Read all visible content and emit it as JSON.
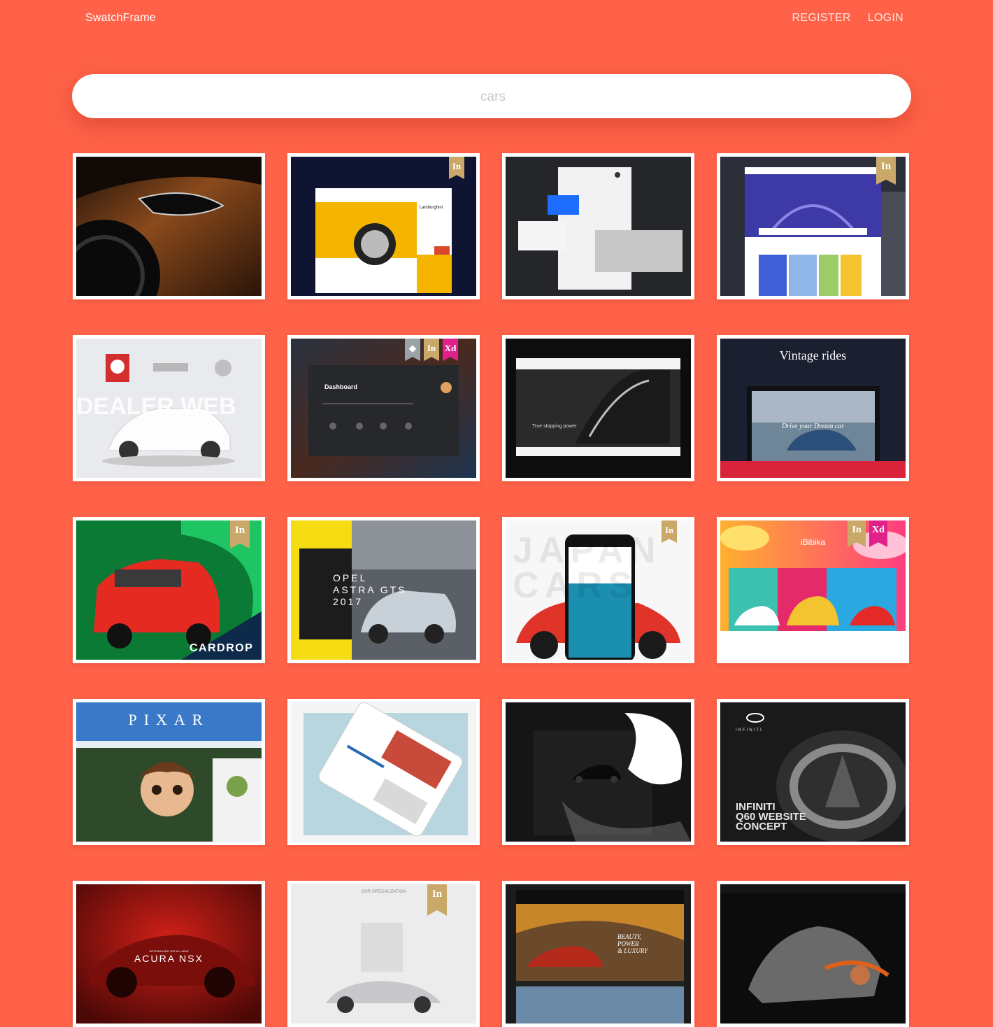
{
  "header": {
    "brand": "SwatchFrame",
    "nav": {
      "register": "REGISTER",
      "login": "LOGIN"
    }
  },
  "search": {
    "placeholder": "cars",
    "value": ""
  },
  "colors": {
    "background": "#FF6248",
    "badge_in": "#C9A86A",
    "badge_xd": "#E0218A"
  },
  "cards": [
    {
      "name": "orange-car-headlight",
      "badges": []
    },
    {
      "name": "lamborghini-site",
      "badges": [
        "In"
      ],
      "texts": [
        "Lamborghini"
      ]
    },
    {
      "name": "dark-stationery-mockup",
      "badges": []
    },
    {
      "name": "tire-shop-site",
      "badges": [
        "In"
      ]
    },
    {
      "name": "dealer-web",
      "badges": [],
      "texts": [
        "DEALER WEB"
      ]
    },
    {
      "name": "hyundai-dashboard",
      "badges": [
        "Sk",
        "In",
        "Xd"
      ],
      "texts": [
        "Dashboard"
      ]
    },
    {
      "name": "dark-car-site",
      "badges": [],
      "texts": [
        "True stopping power"
      ]
    },
    {
      "name": "vintage-rides",
      "badges": [],
      "texts": [
        "Vintage rides",
        "Drive your Dream car"
      ]
    },
    {
      "name": "cardrop",
      "badges": [
        "In"
      ],
      "texts": [
        "CARDROP"
      ]
    },
    {
      "name": "opel-astra",
      "badges": [],
      "texts": [
        "OPEL",
        "ASTRA GTS",
        "2017"
      ]
    },
    {
      "name": "japan-cars-mobile",
      "badges": [
        "In"
      ],
      "texts": [
        "JAPAN",
        "CARS"
      ]
    },
    {
      "name": "ibibika",
      "badges": [
        "In",
        "Xd"
      ],
      "texts": [
        "iBibika"
      ]
    },
    {
      "name": "pixar",
      "badges": [],
      "texts": [
        "PIXAR"
      ]
    },
    {
      "name": "tablet-mockup",
      "badges": []
    },
    {
      "name": "dark-bugatti",
      "badges": []
    },
    {
      "name": "infiniti-q60",
      "badges": [],
      "texts": [
        "INFINITI",
        "INFINITI",
        "Q60 WEBSITE",
        "CONCEPT"
      ]
    },
    {
      "name": "acura-nsx",
      "badges": [],
      "texts": [
        "INTRODUCING THE ALL-NEW",
        "ACURA NSX"
      ]
    },
    {
      "name": "porsche-specialization",
      "badges": [
        "In"
      ],
      "texts": [
        "OUR SPECIALIZATION"
      ]
    },
    {
      "name": "aston-martin",
      "badges": [],
      "texts": [
        "BEAUTY,",
        "POWER",
        "& LUXURY"
      ]
    },
    {
      "name": "dark-concept-car",
      "badges": []
    }
  ]
}
